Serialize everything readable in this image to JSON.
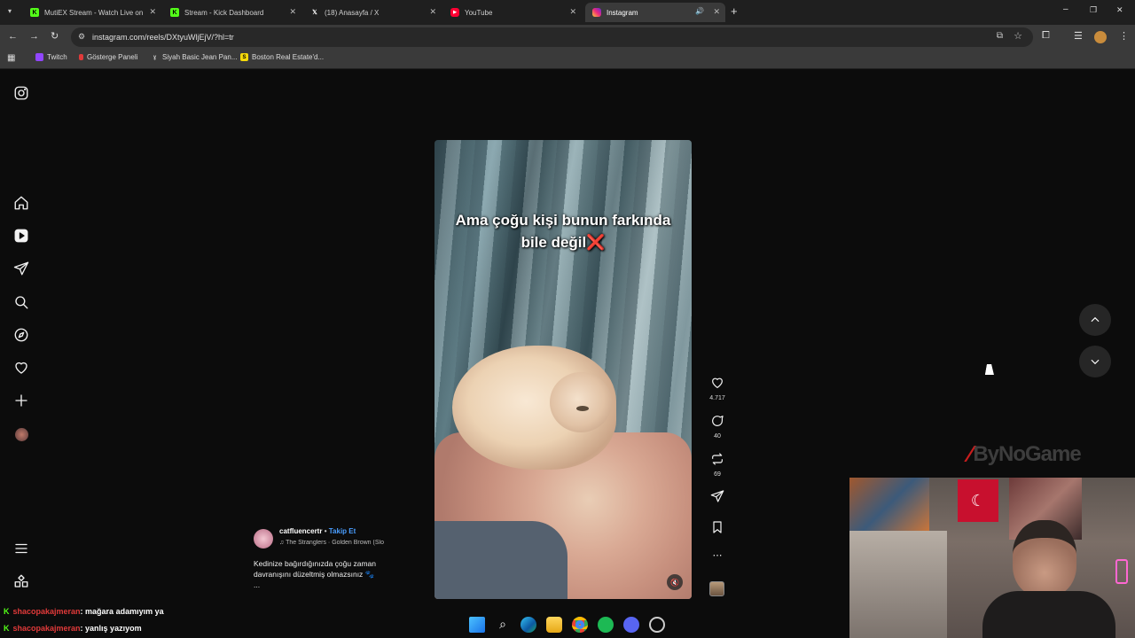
{
  "tabs": [
    {
      "title": "MutiEX Stream - Watch Live on",
      "icon": "kick-icon",
      "color": "#53fc18"
    },
    {
      "title": "Stream - Kick Dashboard",
      "icon": "kick-icon",
      "color": "#53fc18"
    },
    {
      "title": "(18) Anasayfa / X",
      "icon": "x-icon",
      "color": "#ffffff"
    },
    {
      "title": "YouTube",
      "icon": "youtube-icon",
      "color": "#ff0033"
    },
    {
      "title": "Instagram",
      "icon": "instagram-icon",
      "color": "#e1306c",
      "active": true
    }
  ],
  "address": {
    "url": "instagram.com/reels/DXtyuWljEjV/?hl=tr"
  },
  "bookmarks": [
    {
      "label": "Twitch",
      "icon": "twitch-icon",
      "color": "#9146ff"
    },
    {
      "label": "Gösterge Paneli",
      "icon": "dashboard-icon",
      "color": "#e03a3a"
    },
    {
      "label": "Siyah Basic Jean Pan...",
      "icon": "shop-icon",
      "color": "#bbbbbb"
    },
    {
      "label": "Boston Real Estate'd...",
      "icon": "s-icon",
      "color": "#f5d90a"
    }
  ],
  "reel": {
    "overlay_text_line1": "Ama çoğu kişi bunun farkında",
    "overlay_text_line2": "bile değil❌",
    "author": "catfluencertr",
    "separator": "•",
    "follow_label": "Takip Et",
    "music": "The Stranglers · Golden Brown (Slo",
    "caption_line1": "Kedinize bağırdığınızda çoğu zaman",
    "caption_line2": "davranışını düzeltmiş olmazsınız 🐾",
    "caption_more": "...",
    "likes": "4.717",
    "comments": "40",
    "reposts": "69"
  },
  "watermark": "ByNoGame",
  "chat": [
    {
      "user": "shacopakajmeran",
      "message": ": mağara adamıyım ya"
    },
    {
      "user": "shacopakajmeran",
      "message": ": yanlış yazıyom"
    }
  ]
}
